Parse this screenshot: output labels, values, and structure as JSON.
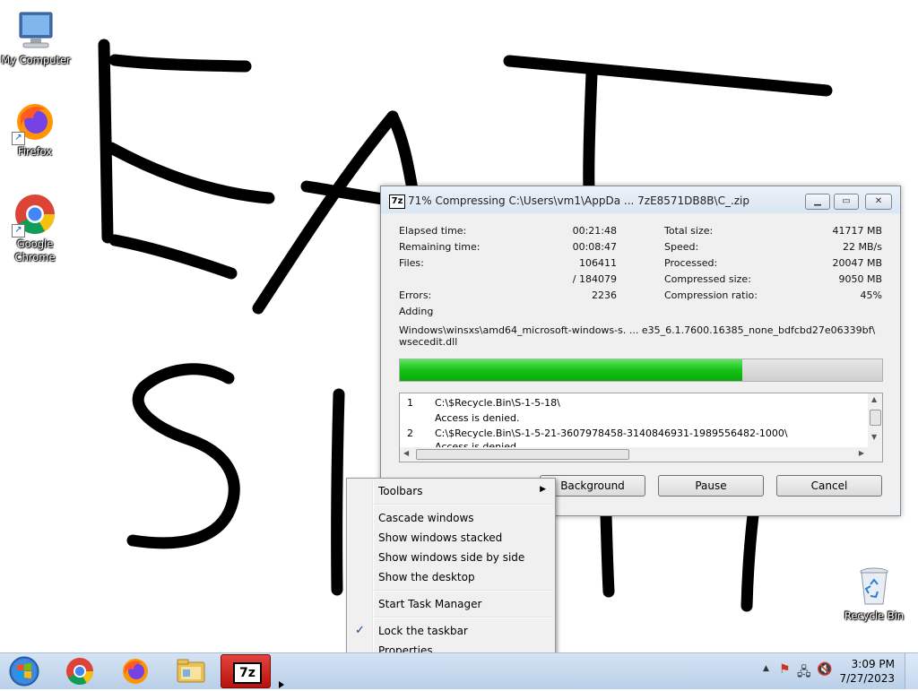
{
  "desktop": {
    "icons": [
      {
        "label": "My Computer"
      },
      {
        "label": "Firefox"
      },
      {
        "label": "Google Chrome"
      },
      {
        "label": "Recycle Bin"
      }
    ],
    "wallpaper_doodle": "EAT SHIT"
  },
  "zip_window": {
    "title": "71% Compressing C:\\Users\\vm1\\AppDa ... 7zE8571DB8B\\C_.zip",
    "stats_left": [
      {
        "label": "Elapsed time:",
        "value": "00:21:48"
      },
      {
        "label": "Remaining time:",
        "value": "00:08:47"
      },
      {
        "label": "Files:",
        "value": "106411"
      },
      {
        "label": "",
        "value": "/ 184079"
      },
      {
        "label": "Errors:",
        "value": "2236"
      }
    ],
    "stats_right": [
      {
        "label": "Total size:",
        "value": "41717 MB"
      },
      {
        "label": "Speed:",
        "value": "22 MB/s"
      },
      {
        "label": "Processed:",
        "value": "20047 MB"
      },
      {
        "label": "Compressed size:",
        "value": "9050 MB"
      },
      {
        "label": "Compression ratio:",
        "value": "45%"
      }
    ],
    "operation": "Adding",
    "current_file_line1": "Windows\\winsxs\\amd64_microsoft-windows-s. ... e35_6.1.7600.16385_none_bdfcbd27e06339bf\\",
    "current_file_line2": "wsecedit.dll",
    "progress_fraction": 0.71,
    "log": [
      {
        "num": "1",
        "path": "C:\\$Recycle.Bin\\S-1-5-18\\",
        "msg": "Access is denied."
      },
      {
        "num": "2",
        "path": "C:\\$Recycle.Bin\\S-1-5-21-3607978458-3140846931-1989556482-1000\\",
        "msg": "Access is denied."
      }
    ],
    "buttons": {
      "background": "Background",
      "pause": "Pause",
      "cancel": "Cancel"
    },
    "colors": {
      "progress": "#16c216"
    }
  },
  "context_menu": {
    "items": [
      {
        "label": "Toolbars",
        "submenu": true
      },
      {
        "label": "Cascade windows"
      },
      {
        "label": "Show windows stacked"
      },
      {
        "label": "Show windows side by side"
      },
      {
        "label": "Show the desktop"
      },
      {
        "label": "Start Task Manager"
      },
      {
        "label": "Lock the taskbar",
        "checked": true
      },
      {
        "label": "Properties"
      }
    ]
  },
  "taskbar": {
    "apps": [
      "chrome-icon",
      "firefox-icon",
      "file-explorer-icon",
      "7zip-icon"
    ],
    "clock": {
      "time": "3:09 PM",
      "date": "7/27/2023"
    }
  }
}
